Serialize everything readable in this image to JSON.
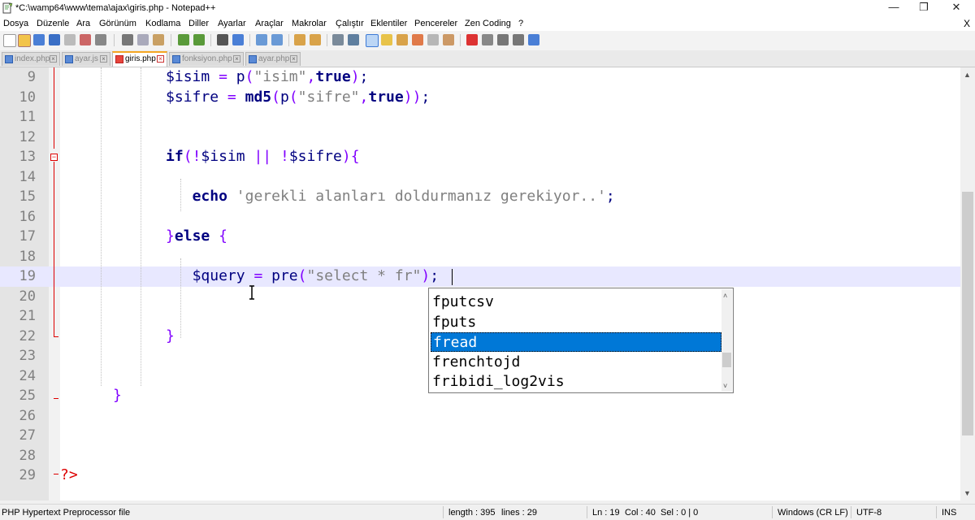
{
  "window": {
    "title": "*C:\\wamp64\\www\\tema\\ajax\\giris.php - Notepad++",
    "minimize": "—",
    "restore": "❐",
    "close": "✕"
  },
  "menu": {
    "items": [
      "Dosya",
      "Düzenle",
      "Ara",
      "Görünüm",
      "Kodlama",
      "Diller",
      "Ayarlar",
      "Araçlar",
      "Makrolar",
      "Çalıştır",
      "Eklentiler",
      "Pencereler",
      "Zen Coding",
      "?"
    ],
    "close_label": "X"
  },
  "tabs": [
    {
      "label": "index.php",
      "active": false
    },
    {
      "label": "ayar.js",
      "active": false
    },
    {
      "label": "giris.php",
      "active": true
    },
    {
      "label": "fonksiyon.php",
      "active": false
    },
    {
      "label": "ayar.php",
      "active": false
    }
  ],
  "editor": {
    "lines": [
      {
        "n": "9",
        "code": "            $isim = p(\"isim\",true);"
      },
      {
        "n": "10",
        "code": "            $sifre = md5(p(\"sifre\",true));"
      },
      {
        "n": "11",
        "code": ""
      },
      {
        "n": "12",
        "code": ""
      },
      {
        "n": "13",
        "code": "            if(!$isim || !$sifre){"
      },
      {
        "n": "14",
        "code": ""
      },
      {
        "n": "15",
        "code": "               echo 'gerekli alanları doldurmanız gerekiyor..';"
      },
      {
        "n": "16",
        "code": ""
      },
      {
        "n": "17",
        "code": "            }else {"
      },
      {
        "n": "18",
        "code": ""
      },
      {
        "n": "19",
        "code": "               $query = pre(\"select * fr\");"
      },
      {
        "n": "20",
        "code": ""
      },
      {
        "n": "21",
        "code": ""
      },
      {
        "n": "22",
        "code": "            }"
      },
      {
        "n": "23",
        "code": ""
      },
      {
        "n": "24",
        "code": ""
      },
      {
        "n": "25",
        "code": "      }"
      },
      {
        "n": "26",
        "code": ""
      },
      {
        "n": "27",
        "code": ""
      },
      {
        "n": "28",
        "code": ""
      },
      {
        "n": "29",
        "code": "?>"
      }
    ],
    "current_line": "19"
  },
  "autocomplete": {
    "items": [
      "fputcsv",
      "fputs",
      "fread",
      "frenchtojd",
      "fribidi_log2vis"
    ],
    "selected": "fread"
  },
  "status": {
    "file_type": "PHP Hypertext Preprocessor file",
    "length": "length : 395",
    "lines": "lines : 29",
    "position": "Ln : 19",
    "col": "Col : 40",
    "sel": "Sel : 0 | 0",
    "eol": "Windows (CR LF)",
    "encoding": "UTF-8",
    "mode": "INS"
  },
  "colors": {
    "keyword": "#000080",
    "string": "#808080",
    "operator": "#8000ff",
    "current_line_bg": "#e8e8ff",
    "selection_bg": "#0078d7",
    "active_tab_accent": "#f5a623"
  }
}
